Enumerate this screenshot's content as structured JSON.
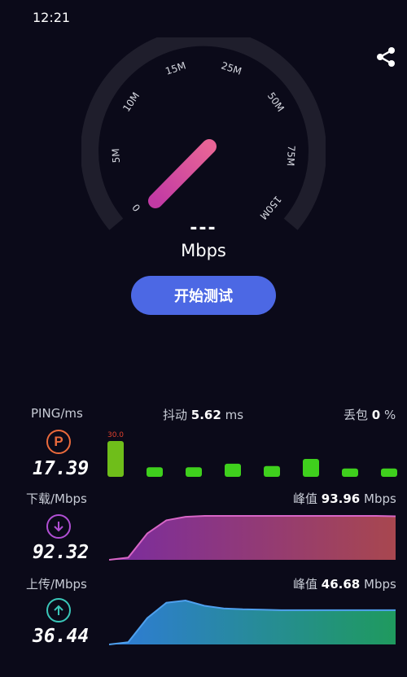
{
  "status_bar": {
    "time": "12:21"
  },
  "icons": {
    "share": "share-icon",
    "ping": "P",
    "download": "arrow-down-icon",
    "upload": "arrow-up-icon"
  },
  "gauge": {
    "ticks": [
      "0",
      "5M",
      "10M",
      "15M",
      "25M",
      "50M",
      "75M",
      "150M"
    ],
    "speed_value": "---",
    "unit": "Mbps",
    "colors": {
      "track": "#1f1e2c",
      "needle_start": "#c23aa4",
      "needle_end": "#e86496"
    }
  },
  "start_button": {
    "label": "开始测试",
    "color": "#4c68e4"
  },
  "ping": {
    "label": "PING/ms",
    "value": "17.39",
    "max_label": "30.0",
    "bars": [
      30,
      8,
      8,
      11,
      9,
      15,
      7,
      7
    ],
    "bar_color": "#3fd01d"
  },
  "jitter": {
    "label": "抖动",
    "value": "5.62",
    "unit": "ms"
  },
  "loss": {
    "label": "丢包",
    "value": "0",
    "unit": "%"
  },
  "download": {
    "label": "下载/Mbps",
    "value": "92.32",
    "peak_label": "峰值",
    "peak_value": "93.96",
    "peak_unit": "Mbps",
    "curve": [
      0,
      0.05,
      0.6,
      0.9,
      0.98,
      1.0,
      1.0,
      1.0,
      1.0,
      1.0,
      1.0,
      1.0,
      1.0,
      1.0,
      1.0,
      0.99
    ],
    "colors": [
      "#7a2ca0",
      "#a8474f"
    ]
  },
  "upload": {
    "label": "上传/Mbps",
    "value": "36.44",
    "peak_label": "峰值",
    "peak_value": "46.68",
    "peak_unit": "Mbps",
    "curve": [
      0,
      0.05,
      0.6,
      0.95,
      1.0,
      0.88,
      0.82,
      0.8,
      0.79,
      0.78,
      0.78,
      0.78,
      0.78,
      0.78,
      0.78,
      0.78
    ],
    "colors": [
      "#2f7bd8",
      "#1f9a5e"
    ]
  }
}
